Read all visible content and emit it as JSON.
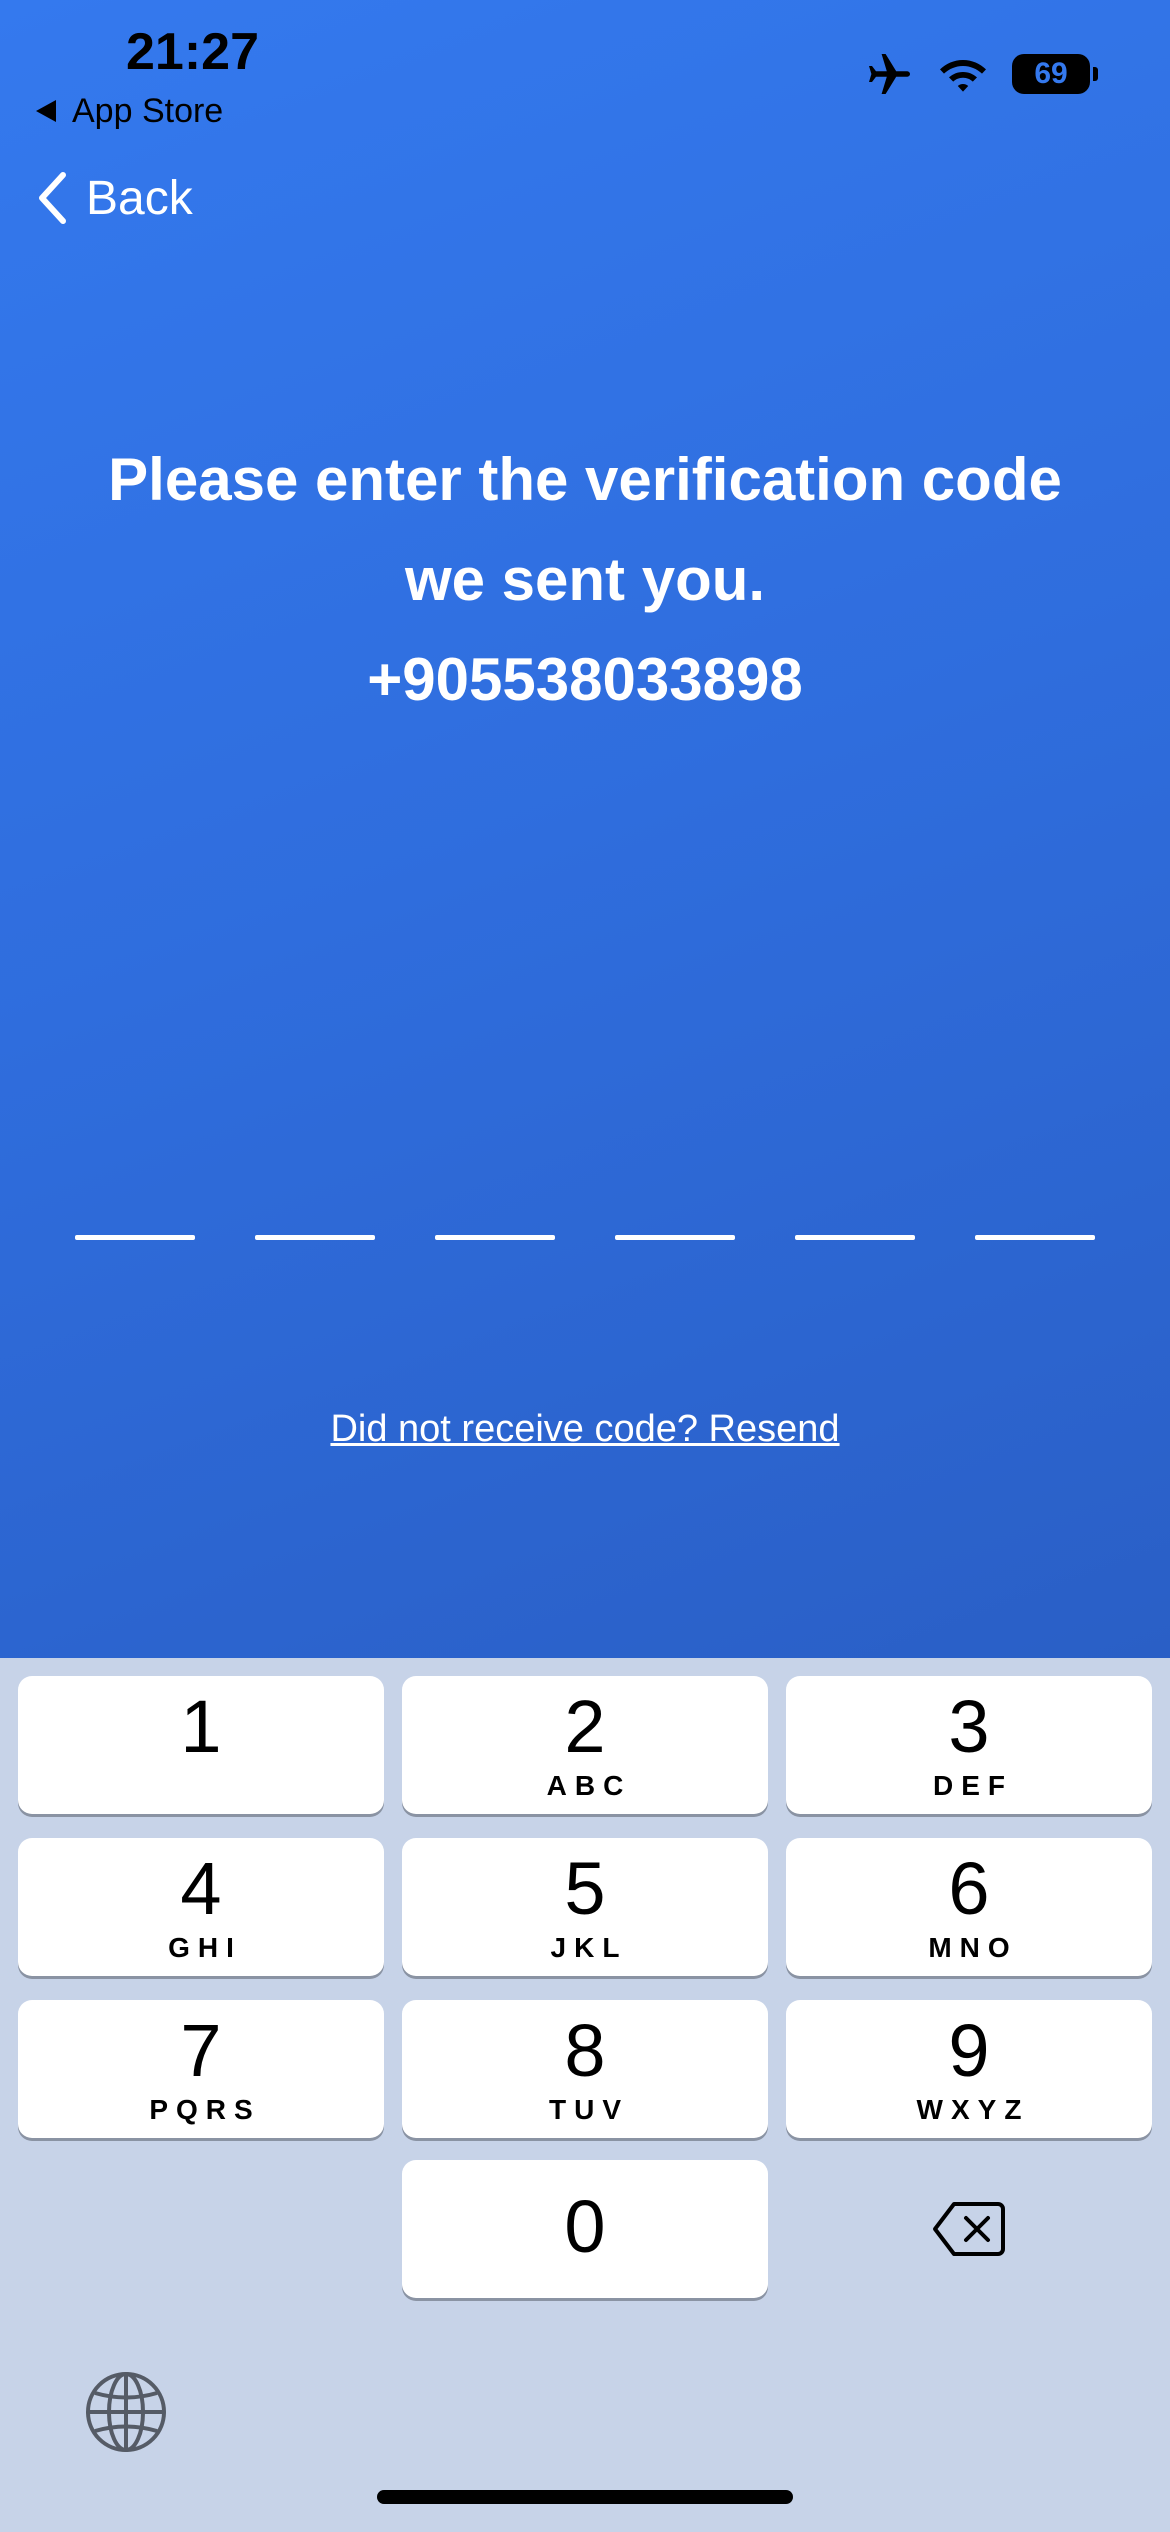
{
  "status_bar": {
    "time": "21:27",
    "back_app": "App Store",
    "battery": "69",
    "icons": [
      "airplane-icon",
      "wifi-icon",
      "battery-icon"
    ]
  },
  "nav": {
    "back_label": "Back"
  },
  "message": {
    "line1": "Please enter the verification code",
    "line2": "we sent you.",
    "phone": "+905538033898"
  },
  "code": {
    "length": 6
  },
  "resend": "Did not receive code? Resend",
  "keypad": {
    "keys": [
      {
        "digit": "1",
        "letters": ""
      },
      {
        "digit": "2",
        "letters": "ABC"
      },
      {
        "digit": "3",
        "letters": "DEF"
      },
      {
        "digit": "4",
        "letters": "GHI"
      },
      {
        "digit": "5",
        "letters": "JKL"
      },
      {
        "digit": "6",
        "letters": "MNO"
      },
      {
        "digit": "7",
        "letters": "PQRS"
      },
      {
        "digit": "8",
        "letters": "TUV"
      },
      {
        "digit": "9",
        "letters": "WXYZ"
      },
      {
        "digit": "0",
        "letters": ""
      }
    ]
  },
  "colors": {
    "background_top": "#3479ee",
    "background_bottom": "#2a5fc6",
    "keyboard": "#c7d3e8"
  }
}
